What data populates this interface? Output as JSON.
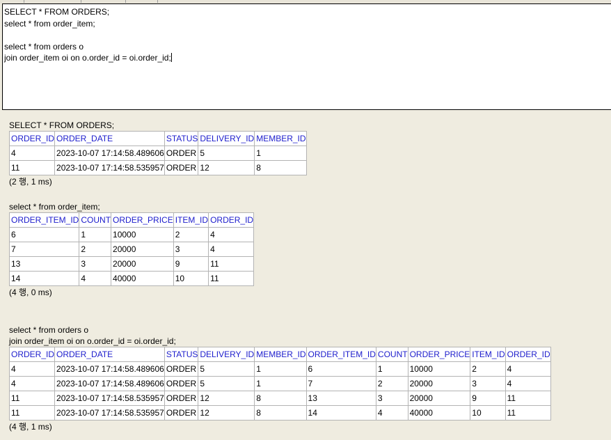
{
  "editor": {
    "lines": [
      "SELECT * FROM ORDERS;",
      "select * from order_item;",
      "",
      "select * from orders o",
      "join order_item oi on o.order_id = oi.order_id;"
    ]
  },
  "results": [
    {
      "query": [
        "SELECT * FROM ORDERS;"
      ],
      "columns": [
        "ORDER_ID",
        "ORDER_DATE",
        "STATUS",
        "DELIVERY_ID",
        "MEMBER_ID"
      ],
      "rows": [
        [
          "4",
          "2023-10-07 17:14:58.489606",
          "ORDER",
          "5",
          "1"
        ],
        [
          "11",
          "2023-10-07 17:14:58.535957",
          "ORDER",
          "12",
          "8"
        ]
      ],
      "summary": "(2 행, 1 ms)"
    },
    {
      "query": [
        "select * from order_item;"
      ],
      "columns": [
        "ORDER_ITEM_ID",
        "COUNT",
        "ORDER_PRICE",
        "ITEM_ID",
        "ORDER_ID"
      ],
      "rows": [
        [
          "6",
          "1",
          "10000",
          "2",
          "4"
        ],
        [
          "7",
          "2",
          "20000",
          "3",
          "4"
        ],
        [
          "13",
          "3",
          "20000",
          "9",
          "11"
        ],
        [
          "14",
          "4",
          "40000",
          "10",
          "11"
        ]
      ],
      "summary": "(4 행, 0 ms)"
    },
    {
      "query": [
        "select * from orders o",
        "join order_item oi on o.order_id = oi.order_id;"
      ],
      "columns": [
        "ORDER_ID",
        "ORDER_DATE",
        "STATUS",
        "DELIVERY_ID",
        "MEMBER_ID",
        "ORDER_ITEM_ID",
        "COUNT",
        "ORDER_PRICE",
        "ITEM_ID",
        "ORDER_ID"
      ],
      "rows": [
        [
          "4",
          "2023-10-07 17:14:58.489606",
          "ORDER",
          "5",
          "1",
          "6",
          "1",
          "10000",
          "2",
          "4"
        ],
        [
          "4",
          "2023-10-07 17:14:58.489606",
          "ORDER",
          "5",
          "1",
          "7",
          "2",
          "20000",
          "3",
          "4"
        ],
        [
          "11",
          "2023-10-07 17:14:58.535957",
          "ORDER",
          "12",
          "8",
          "13",
          "3",
          "20000",
          "9",
          "11"
        ],
        [
          "11",
          "2023-10-07 17:14:58.535957",
          "ORDER",
          "12",
          "8",
          "14",
          "4",
          "40000",
          "10",
          "11"
        ]
      ],
      "summary": "(4 행, 1 ms)"
    }
  ]
}
